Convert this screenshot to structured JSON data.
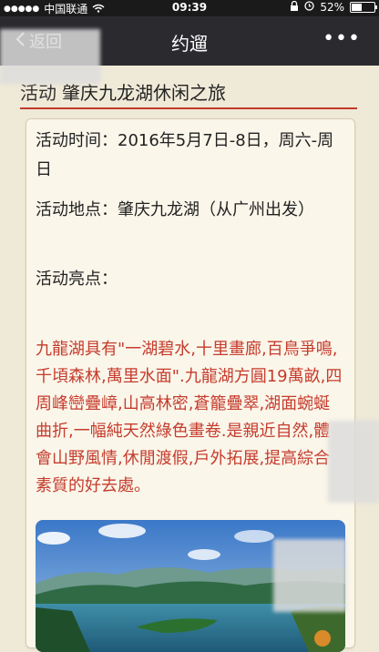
{
  "status": {
    "carrier": "中国联通",
    "time": "09:39",
    "battery": "52%",
    "battery_level": 0.52
  },
  "nav": {
    "back_label": "返回",
    "title": "约遛",
    "more_label": "•••"
  },
  "header": {
    "prefix": "活动",
    "title": "肇庆九龙湖休闲之旅"
  },
  "details": {
    "time_label": "活动时间：",
    "time_value": "2016年5月7日-8日，周六-周日",
    "place_label": "活动地点：",
    "place_value": "肇庆九龙湖（从广州出发）",
    "highlight_label": "活动亮点："
  },
  "description": "九龍湖具有\"一湖碧水,十里畫廊,百鳥爭鳴,千頃森林,萬里水面\".九龍湖方圓19萬畝,四周峰巒疊嶂,山高林密,蒼籠疊翠,湖面蜿蜒曲折,一幅純天然綠色畫卷.是親近自然,體會山野風情,休閒渡假,戶外拓展,提高綜合素質的好去處。",
  "icons": {
    "back": "back-chevron-icon",
    "more": "more-dots-icon",
    "wifi": "wifi-icon",
    "lock": "lock-icon",
    "alarm": "alarm-icon",
    "battery": "battery-icon"
  }
}
